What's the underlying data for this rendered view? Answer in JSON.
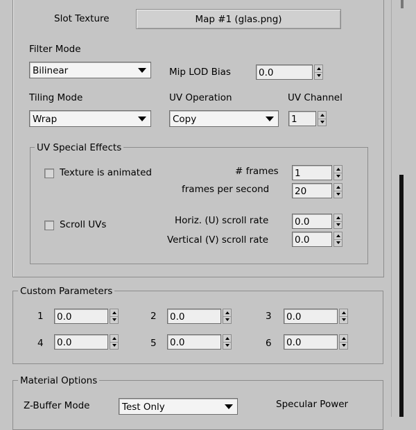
{
  "slot_texture": {
    "label": "Slot Texture",
    "button": "Map #1 (glas.png)"
  },
  "filter_mode": {
    "label": "Filter Mode",
    "value": "Bilinear"
  },
  "mip_lod_bias": {
    "label": "Mip LOD Bias",
    "value": "0.0"
  },
  "tiling_mode": {
    "label": "Tiling Mode",
    "value": "Wrap"
  },
  "uv_operation": {
    "label": "UV Operation",
    "value": "Copy"
  },
  "uv_channel": {
    "label": "UV Channel",
    "value": "1"
  },
  "uv_special_effects": {
    "title": "UV Special Effects",
    "texture_animated": {
      "label": "Texture is animated",
      "checked": false
    },
    "frames": {
      "label": "# frames",
      "value": "1"
    },
    "fps": {
      "label": "frames per second",
      "value": "20"
    },
    "scroll_uvs": {
      "label": "Scroll UVs",
      "checked": false
    },
    "horiz": {
      "label": "Horiz. (U) scroll rate",
      "value": "0.0"
    },
    "vert": {
      "label": "Vertical (V) scroll rate",
      "value": "0.0"
    }
  },
  "custom_parameters": {
    "title": "Custom Parameters",
    "params": [
      {
        "num": "1",
        "value": "0.0"
      },
      {
        "num": "2",
        "value": "0.0"
      },
      {
        "num": "3",
        "value": "0.0"
      },
      {
        "num": "4",
        "value": "0.0"
      },
      {
        "num": "5",
        "value": "0.0"
      },
      {
        "num": "6",
        "value": "0.0"
      }
    ]
  },
  "material_options": {
    "title": "Material Options",
    "zbuffer": {
      "label": "Z-Buffer Mode",
      "value": "Test Only"
    },
    "specular_power": {
      "label": "Specular Power"
    }
  }
}
